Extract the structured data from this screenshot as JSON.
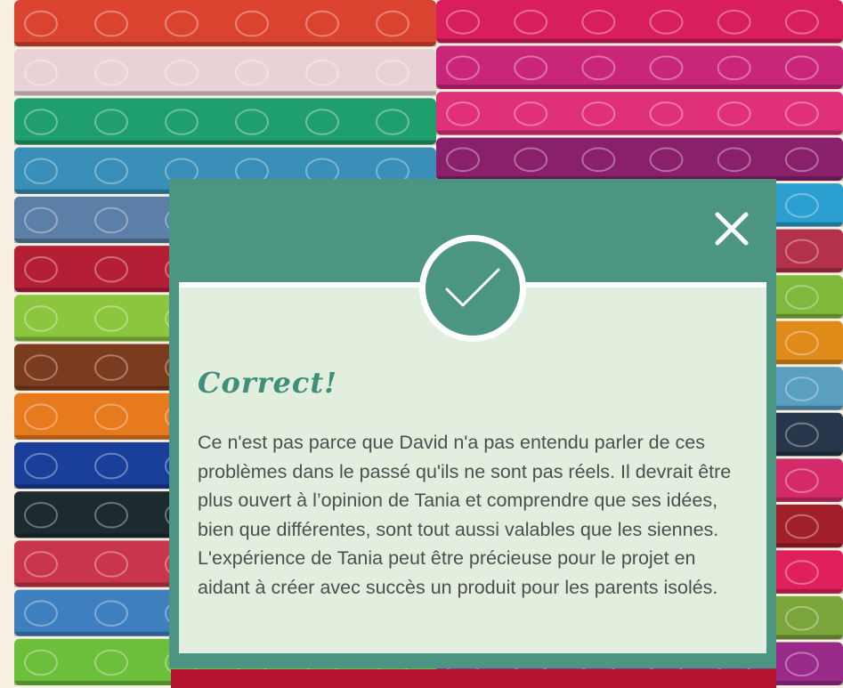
{
  "modal": {
    "title": "Correct!",
    "message": "Ce n'est pas parce que David n'a pas entendu parler de ces problèmes dans le passé qu'ils ne sont pas réels. Il devrait être plus ouvert à l’opinion de Tania et comprendre que ses idées, bien que différentes, sont tout aussi valables que les siennes. L'expérience de Tania peut être précieuse pour le projet en aidant à créer avec succès un produit pour les parents isolés.",
    "close_icon": "close-icon",
    "check_icon": "checkmark-icon"
  },
  "colors": {
    "modal_frame": "#4b9582",
    "modal_body": "#e2efdf",
    "title": "#3e8f79",
    "text": "#4e4e4e",
    "side_panel": "#f6efe2",
    "bottom_strip": "#b5142f"
  },
  "background": {
    "left_stack": [
      "#d9432f",
      "#e9d2d6",
      "#1f9e6e",
      "#3a8fb8",
      "#5b7fa6",
      "#b51f35",
      "#8cc63f",
      "#7a3b1e",
      "#e87a1e",
      "#1a3f9a",
      "#1d2a30",
      "#c9354a",
      "#3e7fbf",
      "#6cbf3a"
    ],
    "right_stack": [
      "#d81e5b",
      "#c9267a",
      "#e0307a",
      "#8a1f6b",
      "#2a9fd0",
      "#b3314a",
      "#7fb83a",
      "#e08a1a",
      "#5a9ec0",
      "#27364a",
      "#d42a6a",
      "#a01f2a",
      "#e0205a",
      "#7aa53a",
      "#9a2a8a"
    ]
  }
}
